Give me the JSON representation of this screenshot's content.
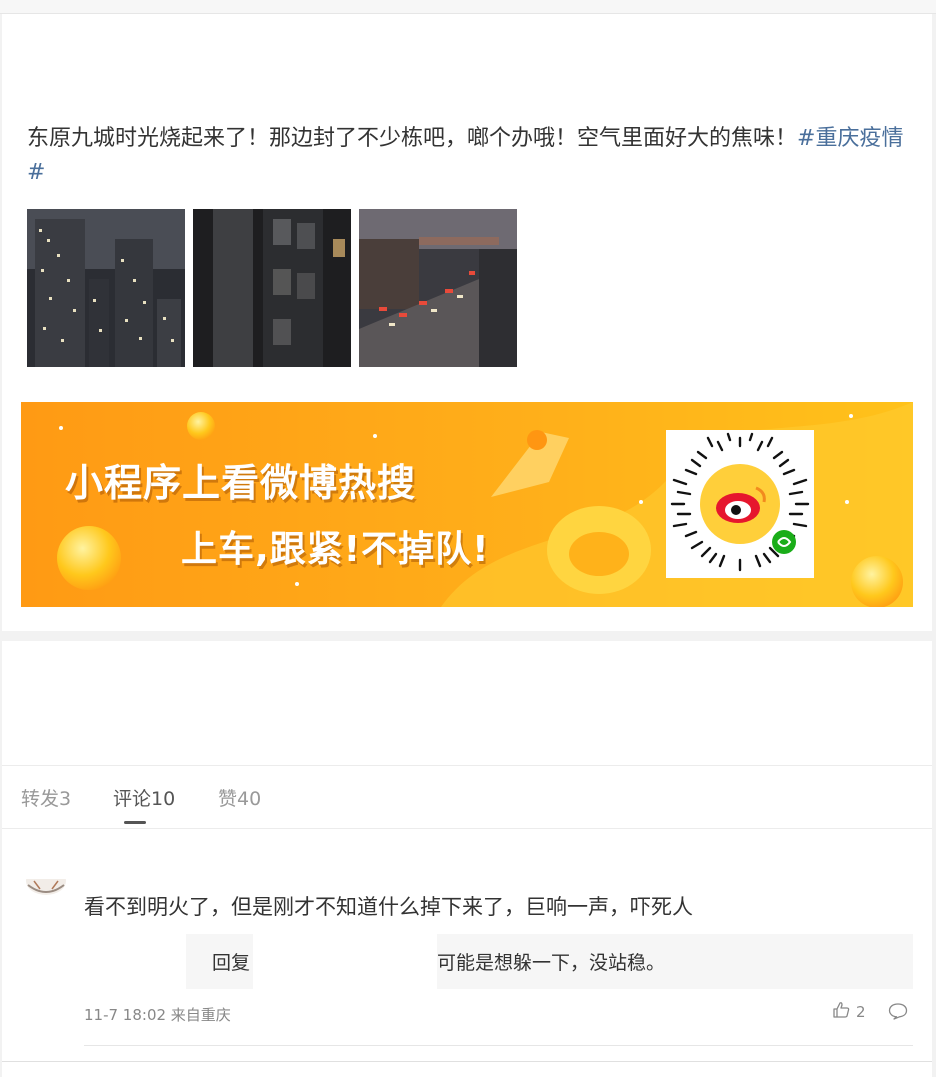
{
  "post": {
    "text": "东原九城时光烧起来了！那边封了不少栋吧，啷个办哦！空气里面好大的焦味！",
    "hashtag": "#重庆疫情#"
  },
  "banner": {
    "line1": "小程序上看微博热搜",
    "line2": "上车,跟紧!不掉队!"
  },
  "tabs": [
    {
      "label": "转发3"
    },
    {
      "label": "评论10"
    },
    {
      "label": "赞40"
    }
  ],
  "comment": {
    "text": "看不到明火了，但是刚才不知道什么掉下来了，巨响一声，吓死人",
    "reply_fragment_a": "回复",
    "reply_fragment_b": "可能是想躲一下，没站稳。",
    "meta": "11-7 18:02 来自重庆",
    "likes": "2"
  },
  "colors": {
    "hashtag": "#4a6f9b",
    "banner_orange": "#ff9a14",
    "banner_yellow": "#ffc21a"
  }
}
